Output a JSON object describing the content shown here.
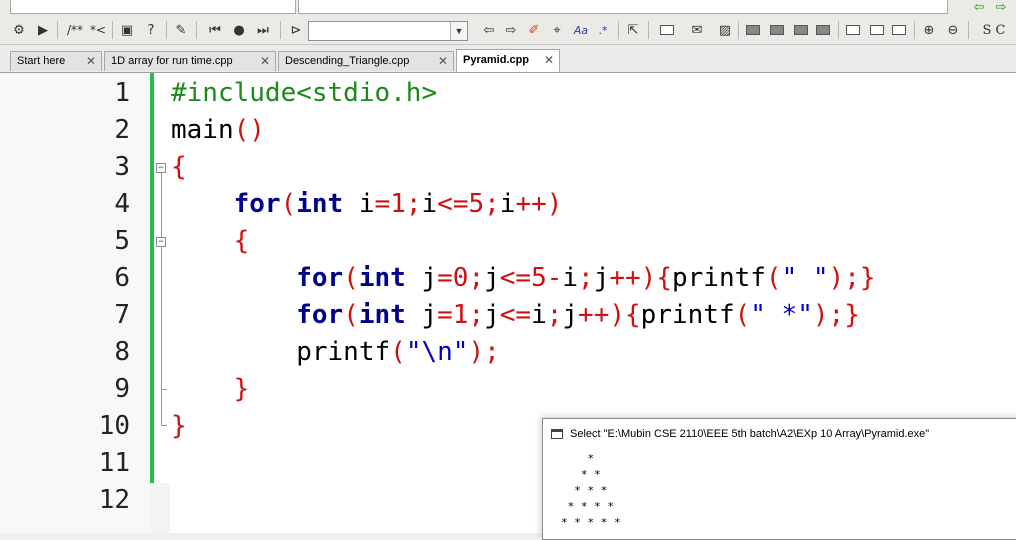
{
  "toolbar": {
    "comment_button": "/**",
    "uncomment_button": "*<",
    "regex_glyph": ".*",
    "highlight_glyph": "Aa",
    "right_glyph": "S C"
  },
  "tabs": [
    {
      "label": "Start here",
      "active": false
    },
    {
      "label": "1D array for run time.cpp",
      "active": false
    },
    {
      "label": "Descending_Triangle.cpp",
      "active": false
    },
    {
      "label": "Pyramid.cpp",
      "active": true
    }
  ],
  "tab_close_glyph": "✕",
  "editor": {
    "line_numbers": [
      "1",
      "2",
      "3",
      "4",
      "5",
      "6",
      "7",
      "8",
      "9",
      "10",
      "11",
      "12"
    ],
    "code_lines": [
      "#include<stdio.h>",
      "main()",
      "{",
      "    for(int i=1;i<=5;i++)",
      "    {",
      "        for(int j=0;j<=5-i;j++){printf(\" \");}",
      "        for(int j=1;j<=i;j++){printf(\" *\");}",
      "        printf(\"\\n\");",
      "    }",
      "}",
      "",
      ""
    ],
    "changebar_color": "#23c04a"
  },
  "console": {
    "title": "Select \"E:\\Mubin CSE 2110\\EEE 5th batch\\A2\\EXp 10 Array\\Pyramid.exe\"",
    "output_lines": [
      "    *",
      "   * *",
      "  * * *",
      " * * * *",
      "* * * * *"
    ]
  }
}
